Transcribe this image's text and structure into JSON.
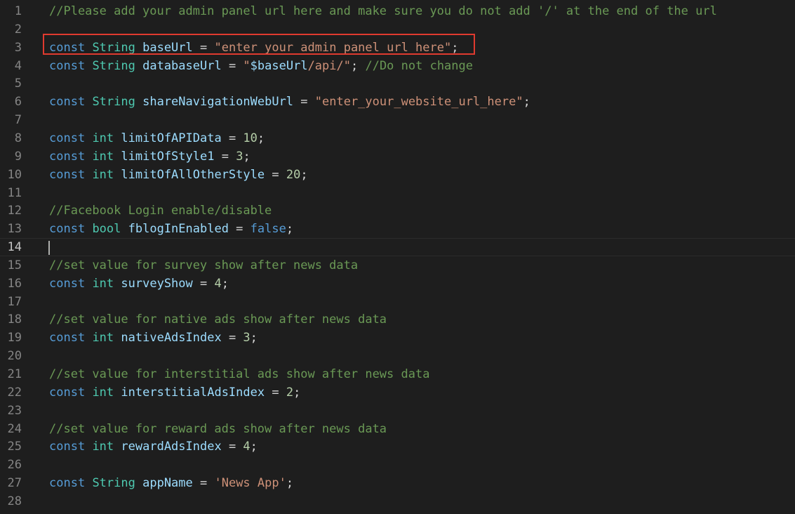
{
  "lines": [
    {
      "n": "1",
      "tokens": [
        {
          "t": "//Please add your admin panel url here and make sure you do not add '/' at the end of the url",
          "c": "cm"
        }
      ]
    },
    {
      "n": "2",
      "tokens": []
    },
    {
      "n": "3",
      "tokens": [
        {
          "t": "const",
          "c": "kw"
        },
        {
          "t": " "
        },
        {
          "t": "String",
          "c": "ty"
        },
        {
          "t": " "
        },
        {
          "t": "baseUrl",
          "c": "id"
        },
        {
          "t": " = "
        },
        {
          "t": "\"enter_your_admin_panel_url_here\"",
          "c": "st"
        },
        {
          "t": ";"
        }
      ]
    },
    {
      "n": "4",
      "tokens": [
        {
          "t": "const",
          "c": "kw"
        },
        {
          "t": " "
        },
        {
          "t": "String",
          "c": "ty"
        },
        {
          "t": " "
        },
        {
          "t": "databaseUrl",
          "c": "id"
        },
        {
          "t": " = "
        },
        {
          "t": "\"",
          "c": "st"
        },
        {
          "t": "$baseUrl",
          "c": "id"
        },
        {
          "t": "/api/\"",
          "c": "st"
        },
        {
          "t": "; "
        },
        {
          "t": "//Do not change",
          "c": "cm"
        }
      ]
    },
    {
      "n": "5",
      "tokens": []
    },
    {
      "n": "6",
      "tokens": [
        {
          "t": "const",
          "c": "kw"
        },
        {
          "t": " "
        },
        {
          "t": "String",
          "c": "ty"
        },
        {
          "t": " "
        },
        {
          "t": "shareNavigationWebUrl",
          "c": "id"
        },
        {
          "t": " = "
        },
        {
          "t": "\"enter_your_website_url_here\"",
          "c": "st"
        },
        {
          "t": ";"
        }
      ]
    },
    {
      "n": "7",
      "tokens": []
    },
    {
      "n": "8",
      "tokens": [
        {
          "t": "const",
          "c": "kw"
        },
        {
          "t": " "
        },
        {
          "t": "int",
          "c": "ty"
        },
        {
          "t": " "
        },
        {
          "t": "limitOfAPIData",
          "c": "id"
        },
        {
          "t": " = "
        },
        {
          "t": "10",
          "c": "nu"
        },
        {
          "t": ";"
        }
      ]
    },
    {
      "n": "9",
      "tokens": [
        {
          "t": "const",
          "c": "kw"
        },
        {
          "t": " "
        },
        {
          "t": "int",
          "c": "ty"
        },
        {
          "t": " "
        },
        {
          "t": "limitOfStyle1",
          "c": "id"
        },
        {
          "t": " = "
        },
        {
          "t": "3",
          "c": "nu"
        },
        {
          "t": ";"
        }
      ]
    },
    {
      "n": "10",
      "tokens": [
        {
          "t": "const",
          "c": "kw"
        },
        {
          "t": " "
        },
        {
          "t": "int",
          "c": "ty"
        },
        {
          "t": " "
        },
        {
          "t": "limitOfAllOtherStyle",
          "c": "id"
        },
        {
          "t": " = "
        },
        {
          "t": "20",
          "c": "nu"
        },
        {
          "t": ";"
        }
      ]
    },
    {
      "n": "11",
      "tokens": []
    },
    {
      "n": "12",
      "tokens": [
        {
          "t": "//Facebook Login enable/disable",
          "c": "cm"
        }
      ]
    },
    {
      "n": "13",
      "tokens": [
        {
          "t": "const",
          "c": "kw"
        },
        {
          "t": " "
        },
        {
          "t": "bool",
          "c": "ty"
        },
        {
          "t": " "
        },
        {
          "t": "fblogInEnabled",
          "c": "id"
        },
        {
          "t": " = "
        },
        {
          "t": "false",
          "c": "kw"
        },
        {
          "t": ";"
        }
      ]
    },
    {
      "n": "14",
      "tokens": [],
      "current": true
    },
    {
      "n": "15",
      "tokens": [
        {
          "t": "//set value for survey show after news data",
          "c": "cm"
        }
      ]
    },
    {
      "n": "16",
      "tokens": [
        {
          "t": "const",
          "c": "kw"
        },
        {
          "t": " "
        },
        {
          "t": "int",
          "c": "ty"
        },
        {
          "t": " "
        },
        {
          "t": "surveyShow",
          "c": "id"
        },
        {
          "t": " = "
        },
        {
          "t": "4",
          "c": "nu"
        },
        {
          "t": ";"
        }
      ]
    },
    {
      "n": "17",
      "tokens": []
    },
    {
      "n": "18",
      "tokens": [
        {
          "t": "//set value for native ads show after news data",
          "c": "cm"
        }
      ]
    },
    {
      "n": "19",
      "tokens": [
        {
          "t": "const",
          "c": "kw"
        },
        {
          "t": " "
        },
        {
          "t": "int",
          "c": "ty"
        },
        {
          "t": " "
        },
        {
          "t": "nativeAdsIndex",
          "c": "id"
        },
        {
          "t": " = "
        },
        {
          "t": "3",
          "c": "nu"
        },
        {
          "t": ";"
        }
      ]
    },
    {
      "n": "20",
      "tokens": []
    },
    {
      "n": "21",
      "tokens": [
        {
          "t": "//set value for interstitial ads show after news data",
          "c": "cm"
        }
      ]
    },
    {
      "n": "22",
      "tokens": [
        {
          "t": "const",
          "c": "kw"
        },
        {
          "t": " "
        },
        {
          "t": "int",
          "c": "ty"
        },
        {
          "t": " "
        },
        {
          "t": "interstitialAdsIndex",
          "c": "id"
        },
        {
          "t": " = "
        },
        {
          "t": "2",
          "c": "nu"
        },
        {
          "t": ";"
        }
      ]
    },
    {
      "n": "23",
      "tokens": []
    },
    {
      "n": "24",
      "tokens": [
        {
          "t": "//set value for reward ads show after news data",
          "c": "cm"
        }
      ]
    },
    {
      "n": "25",
      "tokens": [
        {
          "t": "const",
          "c": "kw"
        },
        {
          "t": " "
        },
        {
          "t": "int",
          "c": "ty"
        },
        {
          "t": " "
        },
        {
          "t": "rewardAdsIndex",
          "c": "id"
        },
        {
          "t": " = "
        },
        {
          "t": "4",
          "c": "nu"
        },
        {
          "t": ";"
        }
      ]
    },
    {
      "n": "26",
      "tokens": []
    },
    {
      "n": "27",
      "tokens": [
        {
          "t": "const",
          "c": "kw"
        },
        {
          "t": " "
        },
        {
          "t": "String",
          "c": "ty"
        },
        {
          "t": " "
        },
        {
          "t": "appName",
          "c": "id"
        },
        {
          "t": " = "
        },
        {
          "t": "'News App'",
          "c": "st"
        },
        {
          "t": ";"
        }
      ]
    },
    {
      "n": "28",
      "tokens": []
    }
  ],
  "colors": {
    "background": "#1e1e1e",
    "keyword": "#569cd6",
    "type": "#4ec9b0",
    "identifier": "#9cdcfe",
    "string": "#ce9178",
    "number": "#b5cea8",
    "comment": "#6a9955",
    "highlight_box": "#e03a2f"
  }
}
